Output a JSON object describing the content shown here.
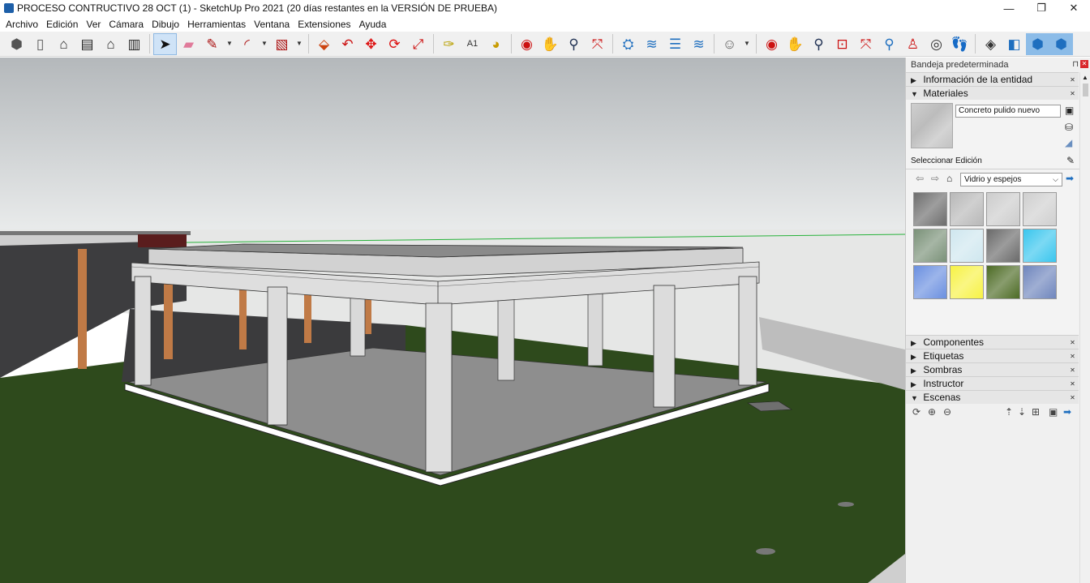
{
  "window": {
    "title": "PROCESO CONTRUCTIVO 28 OCT (1) - SketchUp Pro 2021 (20 días restantes en la VERSIÓN DE PRUEBA)",
    "min_label": "—",
    "max_label": "❐",
    "close_label": "✕"
  },
  "menu": [
    "Archivo",
    "Edición",
    "Ver",
    "Cámara",
    "Dibujo",
    "Herramientas",
    "Ventana",
    "Extensiones",
    "Ayuda"
  ],
  "toolbar": {
    "icons": [
      "iso-view-icon",
      "top-view-icon",
      "front-view-icon",
      "right-view-icon",
      "back-view-icon",
      "left-view-icon",
      "select-arrow-icon",
      "eraser-icon",
      "pencil-line-icon",
      "arc-icon",
      "rectangle-icon",
      "push-pull-icon",
      "offset-icon",
      "move-icon",
      "rotate-icon",
      "scale-icon",
      "tape-measure-icon",
      "text-icon",
      "paint-bucket-icon",
      "orbit-icon",
      "pan-icon",
      "zoom-icon",
      "zoom-extents-icon",
      "solid-tools-icon",
      "styles-icon",
      "layers-icon",
      "sandbox-icon",
      "profile-icon",
      "orbit-2-icon",
      "pan-2-icon",
      "zoom-2-icon",
      "zoom-window-icon",
      "zoom-extents-2-icon",
      "previous-view-icon",
      "position-camera-icon",
      "look-around-icon",
      "walk-icon",
      "section-plane-icon",
      "display-section-icon",
      "section-fill-icon",
      "xray-icon"
    ]
  },
  "tray": {
    "title": "Bandeja predeterminada",
    "pin": "⊓",
    "close": "✕",
    "panels_top": [
      {
        "label": "Información de la entidad",
        "expanded": false
      },
      {
        "label": "Materiales",
        "expanded": true
      }
    ],
    "materials": {
      "current_name": "Concreto pulido nuevo",
      "tab_select": "Seleccionar",
      "tab_edit": "Edición",
      "collection": "Vidrio y espejos",
      "swatch_colors": [
        "#6d6d6d",
        "#b8b8b8",
        "#cccccc",
        "#cfcfcf",
        "#7a9178",
        "#cfe7ef",
        "#6a6a6a",
        "#3ac6ee",
        "#6a8fe0",
        "#f7f245",
        "#4d6b25",
        "#6f86bd"
      ]
    },
    "panels_bottom": [
      {
        "label": "Componentes",
        "expanded": false
      },
      {
        "label": "Etiquetas",
        "expanded": false
      },
      {
        "label": "Sombras",
        "expanded": false
      },
      {
        "label": "Instructor",
        "expanded": false
      },
      {
        "label": "Escenas",
        "expanded": true
      }
    ]
  },
  "colors": {
    "sky_top": "#b5b9bc",
    "sky_bottom": "#eceeee",
    "grass": "#2e4a1c",
    "concrete": "#dadada",
    "slab": "#8e8e8e",
    "selected_accent": "#2b8cda"
  }
}
